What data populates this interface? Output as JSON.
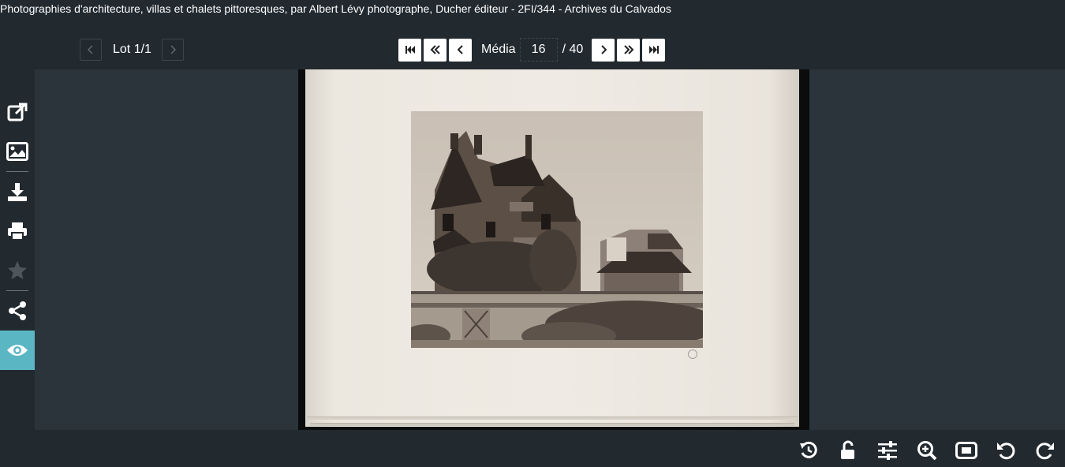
{
  "window": {
    "title": "Photographies d'architecture, villas et chalets pittoresques, par Albert Lévy photographe, Ducher éditeur - 2FI/344 - Archives du Calvados"
  },
  "lot_nav": {
    "label": "Lot 1/1"
  },
  "media_nav": {
    "label": "Média",
    "current": "16",
    "total": "/ 40"
  },
  "sidebar": {
    "items": [
      {
        "name": "open-external",
        "icon": "external-link-icon"
      },
      {
        "name": "image",
        "icon": "image-icon"
      },
      {
        "name": "download",
        "icon": "download-icon"
      },
      {
        "name": "print",
        "icon": "print-icon"
      },
      {
        "name": "favorite",
        "icon": "star-icon"
      },
      {
        "name": "share",
        "icon": "share-icon"
      },
      {
        "name": "view",
        "icon": "eye-icon",
        "active": true
      }
    ]
  },
  "toolbar": {
    "items": [
      "reset-history-icon",
      "unlock-icon",
      "adjust-sliders-icon",
      "zoom-in-icon",
      "fit-screen-icon",
      "rotate-left-icon",
      "rotate-right-icon"
    ]
  },
  "colors": {
    "background": "#222a30",
    "viewer": "#2b343b",
    "accent": "#5bb6c3"
  }
}
